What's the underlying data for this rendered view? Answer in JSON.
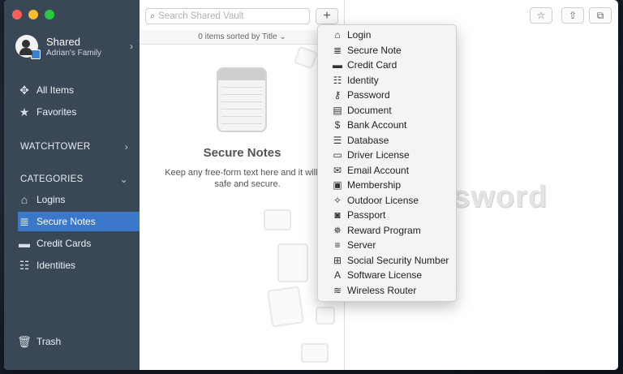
{
  "window": {
    "traffic_colors": [
      "#fe5f57",
      "#febc2e",
      "#28c840"
    ]
  },
  "sidebar": {
    "vault_name": "Shared",
    "vault_sub": "Adrian's Family",
    "all_items": "All Items",
    "favorites": "Favorites",
    "watchtower": "WATCHTOWER",
    "categories": "CATEGORIES",
    "items": [
      {
        "label": "Logins",
        "icon": "login-icon"
      },
      {
        "label": "Secure Notes",
        "icon": "secure-note-icon"
      },
      {
        "label": "Credit Cards",
        "icon": "credit-card-icon"
      },
      {
        "label": "Identities",
        "icon": "identity-icon"
      }
    ],
    "trash": "Trash",
    "selected_color": "#3b78c9"
  },
  "toolbar": {
    "search_placeholder": "Search Shared Vault",
    "plus_label": "+",
    "star_label": "☆",
    "share_label": "⇧",
    "window_label": "⧉"
  },
  "list": {
    "sort_label": "0 items sorted by Title ⌄",
    "empty_title": "Secure Notes",
    "empty_sub": "Keep any free-form text here and it will be safe and secure."
  },
  "detail": {
    "watermark": "ssword"
  },
  "menu": {
    "items": [
      {
        "label": "Login",
        "glyph": "⌂"
      },
      {
        "label": "Secure Note",
        "glyph": "≣"
      },
      {
        "label": "Credit Card",
        "glyph": "▬"
      },
      {
        "label": "Identity",
        "glyph": "☷"
      },
      {
        "label": "Password",
        "glyph": "⚷"
      },
      {
        "label": "Document",
        "glyph": "▤"
      },
      {
        "label": "Bank Account",
        "glyph": "$"
      },
      {
        "label": "Database",
        "glyph": "☰"
      },
      {
        "label": "Driver License",
        "glyph": "▭"
      },
      {
        "label": "Email Account",
        "glyph": "✉"
      },
      {
        "label": "Membership",
        "glyph": "▣"
      },
      {
        "label": "Outdoor License",
        "glyph": "✧"
      },
      {
        "label": "Passport",
        "glyph": "◙"
      },
      {
        "label": "Reward Program",
        "glyph": "✵"
      },
      {
        "label": "Server",
        "glyph": "≡"
      },
      {
        "label": "Social Security Number",
        "glyph": "⊞"
      },
      {
        "label": "Software License",
        "glyph": "A"
      },
      {
        "label": "Wireless Router",
        "glyph": "≋"
      }
    ]
  }
}
